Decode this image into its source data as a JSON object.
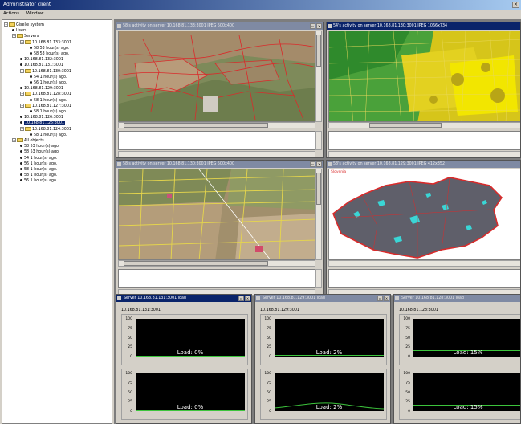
{
  "window": {
    "title": "Administrator client"
  },
  "menu": {
    "items": [
      "Actions",
      "Window"
    ]
  },
  "tree": {
    "root": "Giselle system",
    "users": "Users",
    "servers_label": "Servers",
    "servers": [
      {
        "name": "10.168.81.133:3001",
        "children": [
          "58 53 hour(s) ago.",
          "58 53 hour(s) ago."
        ]
      },
      {
        "name": "10.168.81.132:3001",
        "children": []
      },
      {
        "name": "10.168.81.131:3001",
        "children": []
      },
      {
        "name": "10.168.81.130:3001",
        "children": [
          "54 1 hour(s) ago.",
          "56 1 hour(s) ago."
        ]
      },
      {
        "name": "10.168.81.129:3001",
        "children": []
      },
      {
        "name": "10.168.81.128:3001",
        "children": [
          "58 1 hour(s) ago."
        ]
      },
      {
        "name": "10.168.81.127:3001",
        "children": [
          "58 1 hour(s) ago."
        ]
      },
      {
        "name": "10.168.81.126:3001",
        "children": []
      },
      {
        "name": "10.168.81.125:3001",
        "children": [],
        "selected": true
      },
      {
        "name": "10.168.81.124:3001",
        "children": [
          "58 1 hour(s) ago."
        ]
      }
    ],
    "all_objects_label": "All objects",
    "all_objects": [
      "58 53 hour(s) ago.",
      "58 53 hour(s) ago.",
      "54 1 hour(s) ago.",
      "56 1 hour(s) ago.",
      "58 1 hour(s) ago.",
      "58 1 hour(s) ago.",
      "56 1 hour(s) ago."
    ]
  },
  "activity_windows": [
    {
      "title": "58's activity on server 10.168.81.133:3001 JPEG 500x400"
    },
    {
      "title": "54's activity on server 10.168.81.130:3001 JPEG 1066x734"
    },
    {
      "title": "58's activity on server 10.168.81.130:3001 JPEG 500x400"
    },
    {
      "title": "58's activity on server 10.168.81.129:3001 JPEG 412x352"
    }
  ],
  "map_label": "Slovenia",
  "load_windows": [
    {
      "title": "Server 10.168.81.131:3001 load",
      "server": "10.168.81.131:3001",
      "load1": "Load: 0%",
      "load2": "Load: 0%",
      "level1": 0.0,
      "level2": 0.0
    },
    {
      "title": "Server 10.168.81.129:3001 load",
      "server": "10.168.81.129:3001",
      "load1": "Load: 2%",
      "load2": "Load: 2%",
      "level1": 0.02,
      "level2": 0.02
    },
    {
      "title": "Server 10.168.81.128:3001 load",
      "server": "10.168.81.128:3001",
      "load1": "Load: 15%",
      "load2": "Load: 15%",
      "level1": 0.15,
      "level2": 0.15
    }
  ],
  "ticks": [
    "100",
    "75",
    "50",
    "25",
    "0"
  ],
  "colors": {
    "title_active": "#0a246a",
    "title_inactive": "#7f8aa3",
    "map_red": "#d92b2b",
    "map_yellow": "#f2e600",
    "map_green": "#33a02c",
    "graph_bg": "#000000",
    "graph_line": "#3cc43c"
  }
}
